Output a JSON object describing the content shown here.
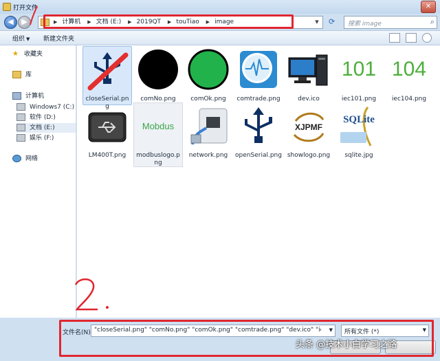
{
  "window": {
    "title": "打开文件"
  },
  "address": {
    "crumbs": [
      "计算机",
      "文档 (E:)",
      "2019QT",
      "touTiao",
      "image"
    ],
    "search_placeholder": "搜索 image"
  },
  "toolbar": {
    "organize": "组织",
    "new_folder": "新建文件夹"
  },
  "nav": [
    {
      "label": "收藏夹",
      "icon": "star-icon"
    },
    {
      "label": "库",
      "icon": "library-icon"
    },
    {
      "label": "计算机",
      "icon": "computer-icon"
    },
    {
      "label": "Windows7 (C:)",
      "icon": "drive-icon"
    },
    {
      "label": "软件 (D:)",
      "icon": "drive-icon"
    },
    {
      "label": "文档 (E:)",
      "icon": "drive-icon"
    },
    {
      "label": "娱乐 (F:)",
      "icon": "drive-icon"
    },
    {
      "label": "网络",
      "icon": "network-icon"
    }
  ],
  "files": [
    {
      "name": "closeSerial.png",
      "icon": "usb-crossed-icon",
      "state": "selected"
    },
    {
      "name": "comNo.png",
      "icon": "black-circle-icon"
    },
    {
      "name": "comOk.png",
      "icon": "green-circle-icon"
    },
    {
      "name": "comtrade.png",
      "icon": "comtrade-icon"
    },
    {
      "name": "dev.ico",
      "icon": "computer-device-icon"
    },
    {
      "name": "iec101.png",
      "icon": "iec101-icon",
      "text": "101"
    },
    {
      "name": "iec104.png",
      "icon": "iec104-icon",
      "text": "104"
    },
    {
      "name": "LM400T.png",
      "icon": "usb-device-icon"
    },
    {
      "name": "modbuslogo.png",
      "icon": "modbus-logo-icon",
      "text": "Mobdus",
      "state": "hover"
    },
    {
      "name": "network.png",
      "icon": "network-plug-icon"
    },
    {
      "name": "openSerial.png",
      "icon": "usb-icon"
    },
    {
      "name": "showlogo.png",
      "icon": "xjpmf-logo-icon",
      "text": "XJPMF"
    },
    {
      "name": "sqlite.jpg",
      "icon": "sqlite-logo-icon",
      "text": "SQLite"
    }
  ],
  "bottom": {
    "filename_label": "文件名(N):",
    "filename_value": "\"closeSerial.png\" \"comNo.png\" \"comOk.png\" \"comtrade.png\" \"dev.ico\" \"iec101.png\" \"ie",
    "filetype_value": "所有文件 (*)"
  },
  "annotations": {
    "mark1": "1",
    "mark2": "2."
  },
  "watermark": "头条 @技术小白学习之路",
  "colors": {
    "annotation_red": "#e0262f",
    "selection": "#d8e8fa",
    "iec_green": "#4caf3a"
  }
}
